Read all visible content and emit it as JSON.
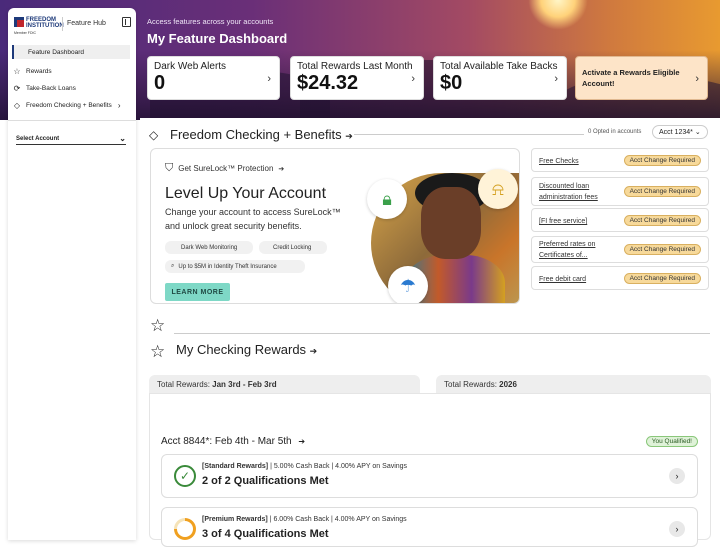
{
  "hero": {
    "subtitle": "Access features across your accounts",
    "title": "My Feature Dashboard",
    "cards": [
      {
        "label": "Dark Web Alerts",
        "value": "0"
      },
      {
        "label": "Total Rewards Last Month",
        "value": "$24.32"
      },
      {
        "label": "Total Available Take Backs",
        "value": "$0"
      },
      {
        "label": "Activate a Rewards Eligible Account!"
      }
    ]
  },
  "sidebar": {
    "logo_text": "FREEDOM INSTITUTION",
    "logo_member": "Member FDIC",
    "hub_label": "Feature Hub",
    "items": [
      {
        "label": "Feature Dashboard",
        "icon": "none"
      },
      {
        "label": "Rewards",
        "icon": "star-icon"
      },
      {
        "label": "Take-Back Loans",
        "icon": "cycle-icon"
      },
      {
        "label": "Freedom Checking + Benefits",
        "icon": "diamond-icon"
      }
    ],
    "select_account": "Select Account"
  },
  "benefits": {
    "title": "Freedom Checking + Benefits",
    "opted": "0 Opted in accounts",
    "account": "Acct 1234*",
    "surelock": "Get SureLock™ Protection",
    "headline": "Level Up Your Account",
    "body": "Change your account to access SureLock™ and unlock great security benefits.",
    "pills": [
      "Dark Web Monitoring",
      "Credit Locking",
      "Up to $5M in Identity Theft Insurance"
    ],
    "learn_more": "LEARN MORE",
    "requirements": [
      {
        "label": "Free Checks",
        "badge": "Acct Change Required"
      },
      {
        "label": "Discounted loan administration fees",
        "badge": "Acct Change Required"
      },
      {
        "label": "[FI free service]",
        "badge": "Acct Change Required"
      },
      {
        "label": "Preferred rates on Certificates of...",
        "badge": "Acct Change Required"
      },
      {
        "label": "Free debit card",
        "badge": "Acct Change Required"
      }
    ]
  },
  "rewards": {
    "title": "My Checking Rewards",
    "tab1_label": "Total Rewards:",
    "tab1_value": "Jan 3rd - Feb 3rd",
    "tab2_label": "Total Rewards:",
    "tab2_value": "2026",
    "acct_line": "Acct 8844*: Feb 4th - Mar 5th",
    "qualified": "You Qualified!",
    "cards": [
      {
        "tier": "[Standard Rewards]",
        "detail": " | 5.00% Cash Back | 4.00% APY on Savings",
        "status": "2 of 2 Qualifications Met",
        "progress": 1.0
      },
      {
        "tier": "[Premium Rewards]",
        "detail": " | 6.00% Cash Back | 4.00% APY on Savings",
        "status": "3 of 4 Qualifications Met",
        "progress": 0.75
      }
    ]
  },
  "colors": {
    "accent": "#1e3a7a",
    "badge": "#f7d99a",
    "learn": "#7ed8c6"
  }
}
